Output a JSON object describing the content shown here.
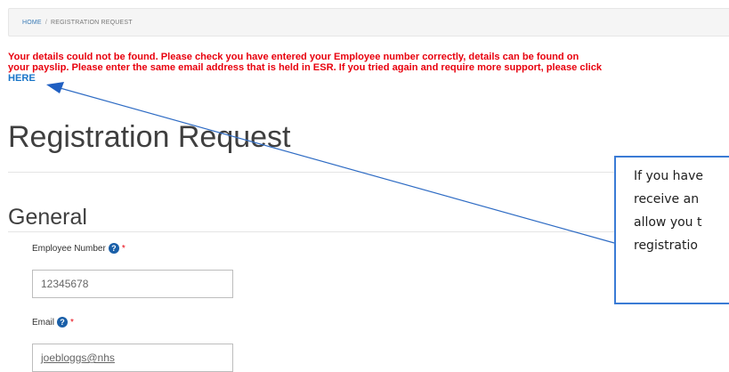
{
  "breadcrumb": {
    "home": "HOME",
    "separator": "/",
    "current": "REGISTRATION REQUEST"
  },
  "error": {
    "line1": "Your details could not be found. Please check you have entered your Employee number correctly, details can be found on",
    "line2": "your payslip. Please enter the same email address that is held in ESR. If you tried again and require more support, please click",
    "link": "HERE"
  },
  "page_title": "Registration Request",
  "section_title": "General",
  "fields": {
    "employee_number": {
      "label": "Employee Number",
      "required": "*",
      "help_icon": "?",
      "value": "12345678"
    },
    "email": {
      "label": "Email",
      "required": "*",
      "help_icon": "?",
      "value": "joebloggs@nhs"
    }
  },
  "callout": {
    "lines": [
      "If you have",
      "receive an",
      "allow you t",
      "registratio"
    ]
  },
  "colors": {
    "error": "#e8000d",
    "link": "#1a76c9",
    "help_icon": "#1a5fa8",
    "callout_border": "#3a7bd5"
  }
}
